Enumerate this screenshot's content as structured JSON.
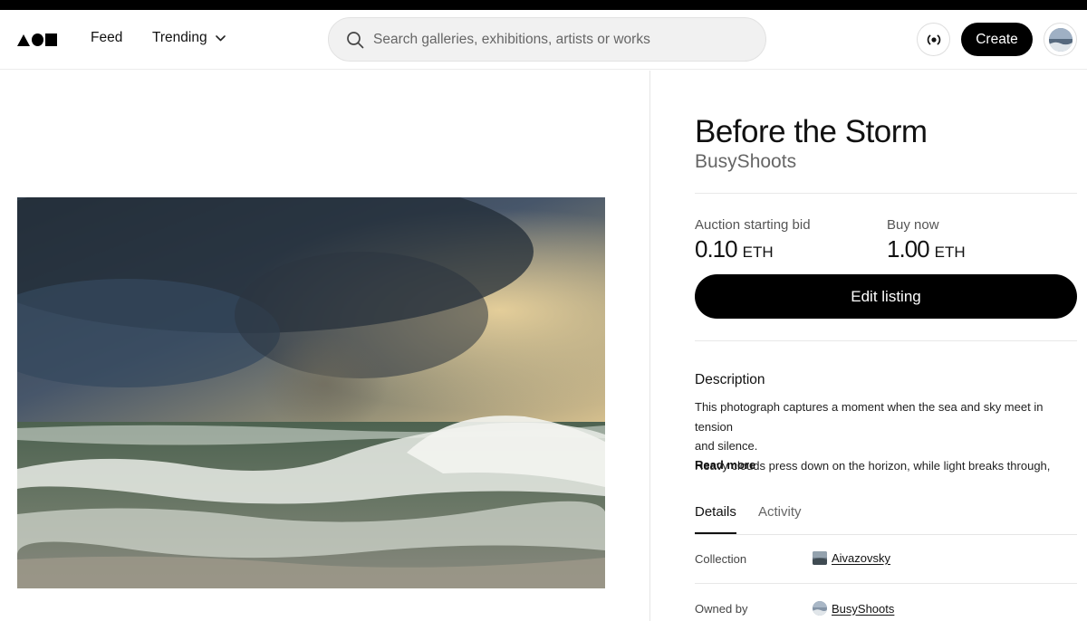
{
  "header": {
    "logo": "logo-icon",
    "nav": {
      "feed": "Feed",
      "trending": "Trending"
    },
    "search": {
      "placeholder": "Search galleries, exhibitions, artists or works",
      "value": ""
    },
    "create_label": "Create"
  },
  "artwork": {
    "title": "Before the Storm",
    "artist": "BusyShoots"
  },
  "pricing": {
    "auction_label": "Auction starting bid",
    "auction_value": "0.10",
    "auction_unit": "ETH",
    "buy_label": "Buy now",
    "buy_value": "1.00",
    "buy_unit": "ETH",
    "edit_label": "Edit listing"
  },
  "description": {
    "heading": "Description",
    "lines": [
      "This photograph captures a moment when the sea and sky meet in tension",
      "and silence.",
      "Heavy clouds press down on the horizon, while light breaks through,"
    ],
    "read_more": "Read more"
  },
  "tabs": {
    "details": "Details",
    "activity": "Activity",
    "active": "details"
  },
  "details": {
    "collection_label": "Collection",
    "collection_value": "Aivazovsky",
    "owner_label": "Owned by",
    "owner_value": "BusyShoots"
  },
  "colors": {
    "primary": "#000000",
    "background": "#ffffff",
    "muted_text": "#666666",
    "search_bg": "#f1f1f1"
  }
}
